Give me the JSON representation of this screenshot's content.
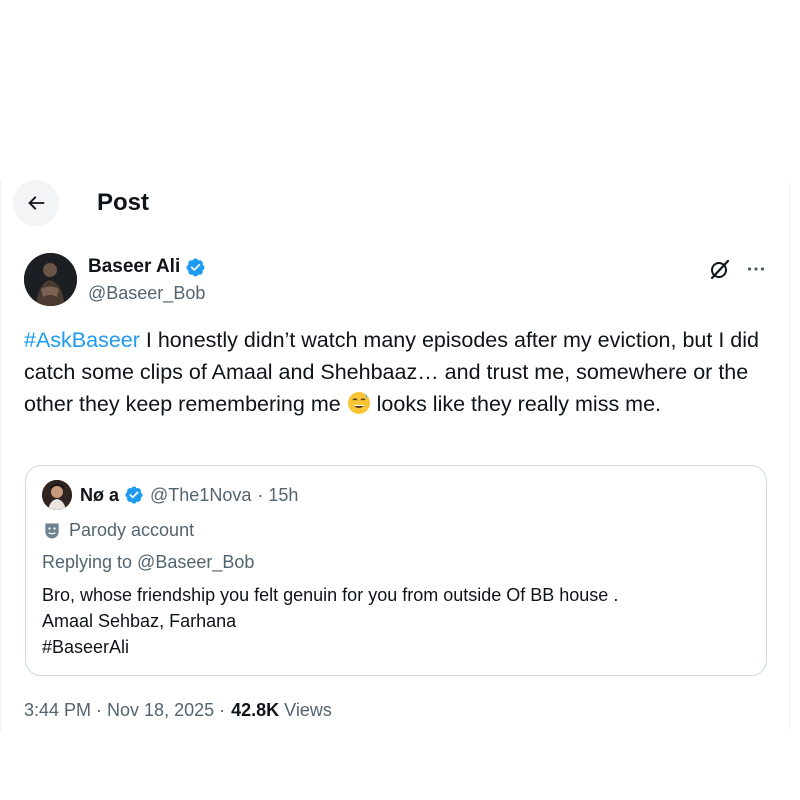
{
  "header": {
    "title": "Post"
  },
  "author": {
    "name": "Baseer Ali",
    "handle": "@Baseer_Bob",
    "verified_color": "#1d9bf0"
  },
  "tweet": {
    "hashtag": "#AskBaseer",
    "text_part1": " I honestly didn’t watch many episodes after my eviction, but I did catch some clips of Amaal and Shehbaaz… and trust me, somewhere or the other they keep remembering me ",
    "emoji": "grinning-face-with-sweat",
    "text_part2": " looks like they really miss me."
  },
  "quote": {
    "name": "Nø  a",
    "handle": "@The1Nova",
    "time": "· 15h",
    "parody_label": "Parody account",
    "replying_to": "Replying to @Baseer_Bob",
    "text": "Bro, whose friendship you felt genuin for you from outside Of BB house .\nAmaal Sehbaz, Farhana\n#BaseerAli"
  },
  "meta": {
    "time_date": "3:44 PM · Nov 18, 2025 ·",
    "views_count": "42.8K",
    "views_label": "Views"
  },
  "colors": {
    "accent": "#1d9bf0",
    "muted": "#536471",
    "text": "#0f1419"
  }
}
